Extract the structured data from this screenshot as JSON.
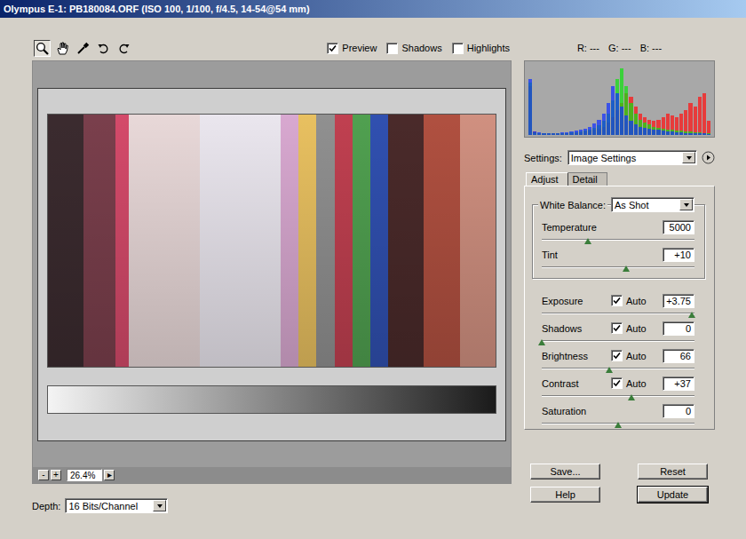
{
  "window": {
    "title": "Olympus E-1: PB180084.ORF  (ISO 100, 1/100, f/4.5, 14-54@54 mm)"
  },
  "tools": [
    {
      "selected": true
    },
    {
      "selected": false
    },
    {
      "selected": false
    },
    {
      "selected": false
    },
    {
      "selected": false
    }
  ],
  "view_options": [
    {
      "label": "Preview",
      "checked": true
    },
    {
      "label": "Shadows",
      "checked": false
    },
    {
      "label": "Highlights",
      "checked": false
    }
  ],
  "readout": [
    {
      "label": "R:",
      "value": "---"
    },
    {
      "label": "G:",
      "value": "---"
    },
    {
      "label": "B:",
      "value": "---"
    }
  ],
  "zoom": {
    "zoom_out": "-",
    "zoom_in": "+",
    "value": "26.4%",
    "menu": "▸"
  },
  "depth": {
    "label": "Depth:",
    "value": "16 Bits/Channel"
  },
  "histogram": {
    "series": [
      {
        "color": "#ff1010",
        "values": [
          70,
          5,
          3,
          2,
          2,
          2,
          2,
          3,
          3,
          3,
          4,
          4,
          5,
          6,
          7,
          9,
          12,
          18,
          25,
          35,
          45,
          60,
          55,
          40,
          30,
          25,
          22,
          20,
          22,
          25,
          30,
          28,
          25,
          30,
          35,
          45,
          40,
          55,
          60,
          20
        ]
      },
      {
        "color": "#10e010",
        "values": [
          75,
          4,
          3,
          3,
          2,
          2,
          2,
          3,
          3,
          4,
          4,
          5,
          6,
          8,
          10,
          14,
          20,
          30,
          50,
          80,
          95,
          70,
          45,
          30,
          22,
          18,
          15,
          12,
          10,
          9,
          8,
          7,
          6,
          6,
          5,
          5,
          4,
          4,
          3,
          2
        ]
      },
      {
        "color": "#1030ff",
        "values": [
          80,
          5,
          4,
          3,
          3,
          3,
          3,
          4,
          4,
          5,
          6,
          7,
          9,
          12,
          16,
          22,
          30,
          45,
          70,
          60,
          40,
          28,
          20,
          15,
          12,
          10,
          9,
          8,
          7,
          6,
          5,
          5,
          4,
          4,
          3,
          3,
          3,
          2,
          2,
          1
        ]
      }
    ]
  },
  "settings": {
    "label": "Settings:",
    "value": "Image Settings"
  },
  "tabs": [
    {
      "label": "Adjust",
      "selected": true
    },
    {
      "label": "Detail",
      "selected": false
    }
  ],
  "white_balance": {
    "label": "White Balance:",
    "value": "As Shot",
    "controls": [
      {
        "kind": "plain",
        "label": "Temperature",
        "value": "5000",
        "level": 0.3
      },
      {
        "kind": "plain",
        "label": "Tint",
        "value": "+10",
        "level": 0.55
      }
    ]
  },
  "tone_controls": [
    {
      "kind": "auto",
      "label": "Exposure",
      "auto_label": "Auto",
      "auto": true,
      "value": "+3.75",
      "level": 0.98
    },
    {
      "kind": "auto",
      "label": "Shadows",
      "auto_label": "Auto",
      "auto": true,
      "value": "0",
      "level": 0.0
    },
    {
      "kind": "auto",
      "label": "Brightness",
      "auto_label": "Auto",
      "auto": true,
      "value": "66",
      "level": 0.44
    },
    {
      "kind": "auto",
      "label": "Contrast",
      "auto_label": "Auto",
      "auto": true,
      "value": "+37",
      "level": 0.59
    },
    {
      "kind": "plain",
      "label": "Saturation",
      "value": "0",
      "level": 0.5
    }
  ],
  "buttons": [
    {
      "label": "Save...",
      "default": false
    },
    {
      "label": "Reset",
      "default": false
    },
    {
      "label": "Help",
      "default": false
    },
    {
      "label": "Update",
      "default": true
    }
  ]
}
